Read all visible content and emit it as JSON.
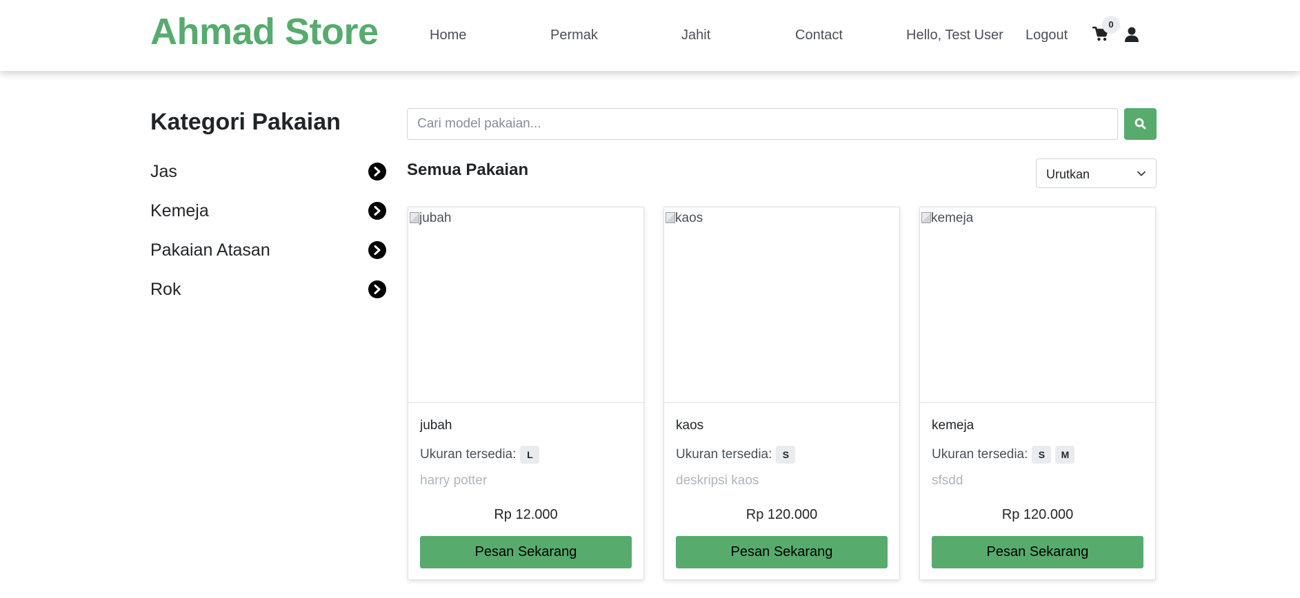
{
  "navbar": {
    "brand": "Ahmad Store",
    "links": [
      "Home",
      "Permak",
      "Jahit",
      "Contact"
    ],
    "greeting": "Hello, Test User",
    "logout": "Logout",
    "cart_count": "0"
  },
  "sidebar": {
    "title": "Kategori Pakaian",
    "categories": [
      "Jas",
      "Kemeja",
      "Pakaian Atasan",
      "Rok"
    ]
  },
  "search": {
    "placeholder": "Cari model pakaian..."
  },
  "main": {
    "section_title": "Semua Pakaian",
    "sort_label": "Urutkan"
  },
  "products": [
    {
      "image_alt": "jubah",
      "name": "jubah",
      "sizes_label": "Ukuran tersedia:",
      "sizes": [
        "L"
      ],
      "description": "harry potter",
      "price": "Rp 12.000",
      "button": "Pesan Sekarang"
    },
    {
      "image_alt": "kaos",
      "name": "kaos",
      "sizes_label": "Ukuran tersedia:",
      "sizes": [
        "S"
      ],
      "description": "deskripsi kaos",
      "price": "Rp 120.000",
      "button": "Pesan Sekarang"
    },
    {
      "image_alt": "kemeja",
      "name": "kemeja",
      "sizes_label": "Ukuran tersedia:",
      "sizes": [
        "S",
        "M"
      ],
      "description": "sfsdd",
      "price": "Rp 120.000",
      "button": "Pesan Sekarang"
    }
  ],
  "colors": {
    "brand_green": "#56ab6d",
    "badge_bg": "#e9ecef",
    "muted_text": "#adb5bd"
  },
  "icons": {
    "cart": "shopping-cart-icon",
    "user": "user-icon",
    "search": "search-icon",
    "category_arrow": "chevron-circle-right-icon",
    "sort": "chevron-down-icon"
  }
}
